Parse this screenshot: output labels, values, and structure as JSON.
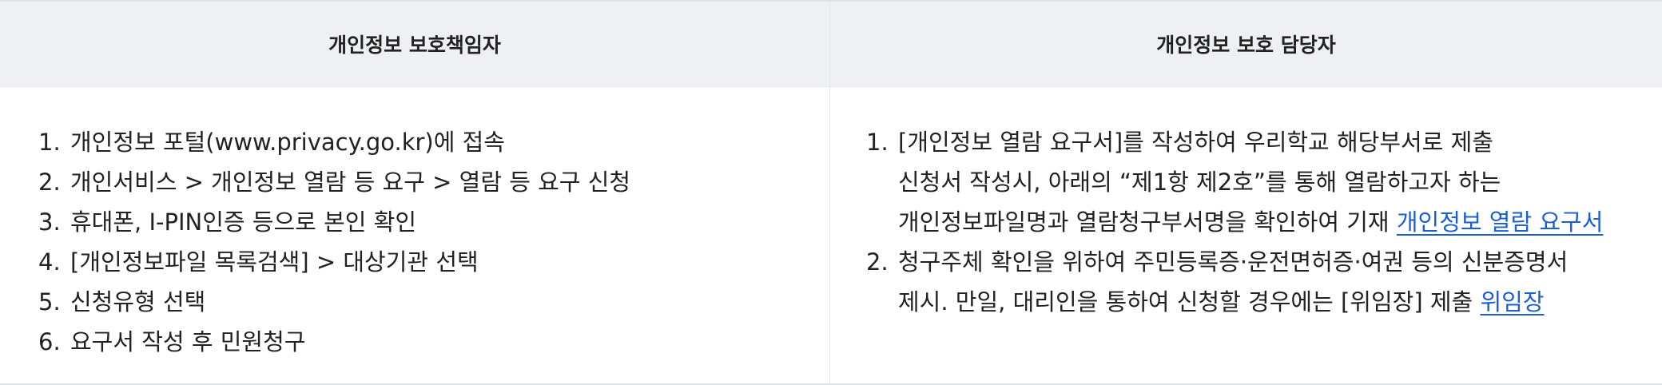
{
  "table": {
    "headers": [
      "개인정보 보호책임자",
      "개인정보 보호 담당자"
    ],
    "left_items": [
      {
        "num": "1.",
        "text": "개인정보 포털(www.privacy.go.kr)에 접속"
      },
      {
        "num": "2.",
        "text": "개인서비스 > 개인정보 열람 등 요구 > 열람 등 요구 신청"
      },
      {
        "num": "3.",
        "text": "휴대폰, I-PIN인증 등으로 본인 확인"
      },
      {
        "num": "4.",
        "text": "[개인정보파일 목록검색] > 대상기관 선택"
      },
      {
        "num": "5.",
        "text": "신청유형 선택"
      },
      {
        "num": "6.",
        "text": "요구서 작성 후 민원청구"
      }
    ],
    "right_items": [
      {
        "num": "1.",
        "line1": "[개인정보 열람 요구서]를 작성하여 우리학교 해당부서로 제출",
        "line2": "신청서 작성시, 아래의 “제1항 제2호”를 통해 열람하고자 하는",
        "line3": "개인정보파일명과 열람청구부서명을 확인하여 기재 ",
        "link": "개인정보 열람 요구서"
      },
      {
        "num": "2.",
        "line1": "청구주체 확인을 위하여 주민등록증·운전면허증·여권 등의 신분증명서",
        "line2": "제시. 만일, 대리인을 통하여 신청할 경우에는 [위임장] 제출 ",
        "link": "위임장"
      }
    ]
  }
}
